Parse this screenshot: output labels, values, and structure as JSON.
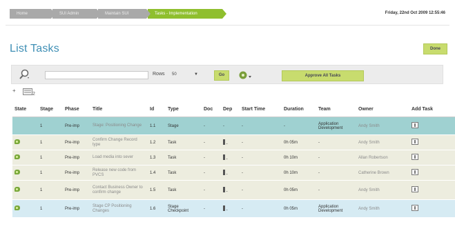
{
  "breadcrumb": [
    "Home",
    "SUI Admin",
    "Maintain SUI",
    "Tasks - Implementation"
  ],
  "datetime": "Friday, 22nd Oct 2009 12:55:46",
  "page_title": "List Tasks",
  "done_label": "Done",
  "toolbar": {
    "search_placeholder": "",
    "rows_label": "Rows",
    "rows_value": "50",
    "go_label": "Go",
    "approve_label": "Approve All Tasks"
  },
  "tree": {
    "bullet": "+",
    "count": "2"
  },
  "table": {
    "headers": [
      "State",
      "Stage",
      "Phase",
      "Title",
      "Id",
      "Type",
      "Doc",
      "Dep",
      "Start Time",
      "Duration",
      "Team",
      "Owner",
      "Add Task"
    ],
    "rows": [
      {
        "stage": "1",
        "phase": "Pre-imp",
        "title": "Stage: Positioning Change",
        "id": "1.1",
        "type": "Stage",
        "doc": "-",
        "dep": "-",
        "start": "-",
        "duration": "-",
        "team": "Application Development",
        "owner": "Andy Smith"
      },
      {
        "stage": "1",
        "phase": "Pre-imp",
        "title": "Confirm Change Record type",
        "id": "1.2",
        "type": "Task",
        "doc": "-",
        "dep": "-",
        "start": "-",
        "duration": "0h 05m",
        "team": "-",
        "owner": "Andy Smith"
      },
      {
        "stage": "1",
        "phase": "Pre-imp",
        "title": "Load media into sever",
        "id": "1.3",
        "type": "Task",
        "doc": "-",
        "dep": "-",
        "start": "-",
        "duration": "0h 10m",
        "team": "-",
        "owner": "Allan Robertson"
      },
      {
        "stage": "1",
        "phase": "Pre-imp",
        "title": "Release new code from PVCS",
        "id": "1.4",
        "type": "Task",
        "doc": "-",
        "dep": "-",
        "start": "-",
        "duration": "0h 10m",
        "team": "-",
        "owner": "Catherine Brown"
      },
      {
        "stage": "1",
        "phase": "Pre-imp",
        "title": "Contact Business Owner to confirm change",
        "id": "1.5",
        "type": "Task",
        "doc": "-",
        "dep": "-",
        "start": "-",
        "duration": "0h 05m",
        "team": "-",
        "owner": "Andy Smith"
      },
      {
        "stage": "1",
        "phase": "Pre-imp",
        "title": "Stage CP Positioning Changes",
        "id": "1.6",
        "type": "Stage Checkpoint",
        "doc": "-",
        "dep": "-",
        "start": "-",
        "duration": "0h 05m",
        "team": "Application Development",
        "owner": "Andy Smith"
      }
    ]
  },
  "colors": {
    "accent": "#3f8fb5",
    "button": "#c8dc6e",
    "selected_row": "#9fd1d1"
  }
}
